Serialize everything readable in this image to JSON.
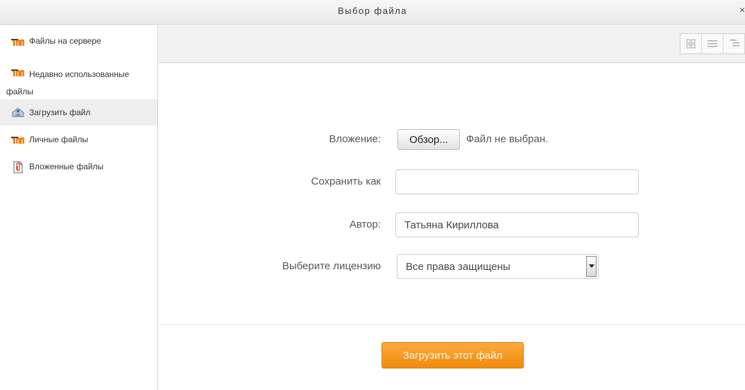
{
  "window": {
    "title": "Выбор файла",
    "close_label": "×"
  },
  "sidebar": {
    "items": [
      {
        "label": "Файлы на сервере",
        "icon": "moodle-icon"
      },
      {
        "label": "Недавно использованные файлы",
        "icon": "moodle-icon"
      },
      {
        "label": "Загрузить файл",
        "icon": "upload-icon",
        "active": true
      },
      {
        "label": "Личные файлы",
        "icon": "moodle-icon"
      },
      {
        "label": "Вложенные файлы",
        "icon": "attachment-icon"
      }
    ]
  },
  "toolbar": {
    "view_buttons": [
      "grid-view-icon",
      "list-view-icon",
      "tree-view-icon"
    ]
  },
  "form": {
    "attachment_label": "Вложение:",
    "browse_label": "Обзор...",
    "no_file_text": "Файл не выбран.",
    "save_as_label": "Сохранить как",
    "save_as_value": "",
    "author_label": "Автор:",
    "author_value": "Татьяна Кириллова",
    "license_label": "Выберите лицензию",
    "license_value": "Все права защищены"
  },
  "actions": {
    "upload_label": "Загрузить этот файл"
  },
  "colors": {
    "accent": "#f39a22",
    "sidebar_active": "#eeeeee",
    "moodle_orange": "#e8841a"
  }
}
